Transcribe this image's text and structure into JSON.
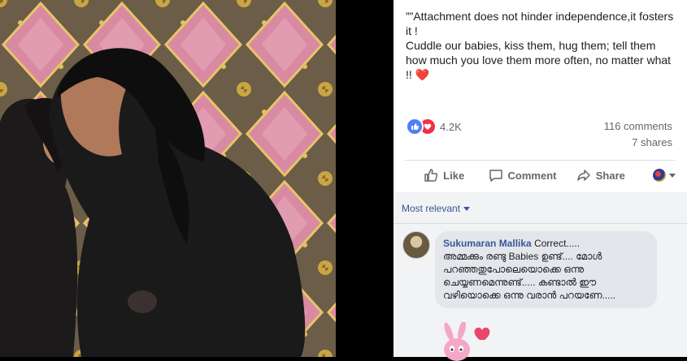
{
  "post": {
    "text_lines": [
      "””Attachment does not hinder independence,it fosters it !",
      "Cuddle our babies, kiss them, hug them; tell them how much you love them more often, no matter what !! ❤️"
    ]
  },
  "stats": {
    "reaction_count": "4.2K",
    "comments": "116 comments",
    "shares": "7 shares"
  },
  "actions": {
    "like": "Like",
    "comment": "Comment",
    "share": "Share"
  },
  "sort": {
    "label": "Most relevant"
  },
  "comment": {
    "author": "Sukumaran Mallika",
    "first_line": "Correct.....",
    "body": "അമ്മക്കും രണ്ടു Babies ഉണ്ട്.... മോൾ പറഞ്ഞതുപോലെയൊക്കെ ഒന്നു ചെയ്യണമെന്നുണ്ട്..... കണ്ടാൽ ഈ വഴിയൊക്കെ ഒന്നു വരാൻ പറയണേ....."
  },
  "colors": {
    "link": "#385898",
    "muted": "#606770",
    "like_blue": "#4e7ff5",
    "love_red": "#f0304a",
    "door_pink": "#d98aa3",
    "door_brass": "#c9a544"
  },
  "icons": [
    "like-icon",
    "love-icon",
    "thumb-icon",
    "comment-icon",
    "share-icon",
    "caret-down-icon",
    "sticker-icon"
  ]
}
